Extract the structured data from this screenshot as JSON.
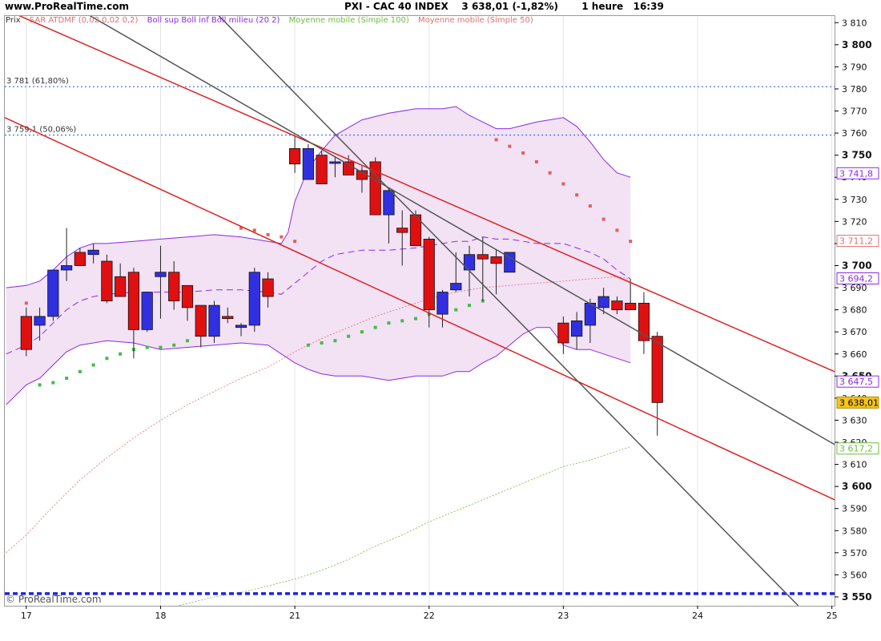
{
  "header": {
    "site": "www.ProRealTime.com",
    "title": "PXI - CAC 40 INDEX    3 638,01 (-1,82%)       1 heure   16:39"
  },
  "watermark": "© ProRealTime.com",
  "legend": [
    {
      "label": "Prix",
      "color": "#333333"
    },
    {
      "label": "SAR ATDMF (0,02 0,02 0,2)",
      "color": "#e07070"
    },
    {
      "label": "Boll sup Boll inf Boll milieu (20 2)",
      "color": "#8a2be2"
    },
    {
      "label": "Moyenne mobile (Simple 100)",
      "color": "#6bbf3a"
    },
    {
      "label": "Moyenne mobile (Simple 50)",
      "color": "#e07070"
    }
  ],
  "colors": {
    "up": "#3030e0",
    "down": "#e01010",
    "band_fill": "#f2e2f4",
    "band_line": "#8a2be2",
    "sar_up": "#44bb44",
    "sar_down": "#e06060",
    "trend_red": "#dd2222",
    "trend_gray": "#555555",
    "fib": "#3366ff",
    "support": "#2222dd",
    "ma50": "#e07070",
    "ma100": "#6bbf3a"
  },
  "chart_data": {
    "type": "candlestick",
    "y_ticks": [
      "3 550",
      "3 560",
      "3 570",
      "3 580",
      "3 590",
      "3 600",
      "3 610",
      "3 620",
      "3 630",
      "3 640",
      "3 650",
      "3 660",
      "3 670",
      "3 680",
      "3 690",
      "3 700",
      "3 710",
      "3 720",
      "3 730",
      "3 740",
      "3 750",
      "3 760",
      "3 770",
      "3 780",
      "3 790",
      "3 800",
      "3 810"
    ],
    "y_tick_values": [
      3550,
      3560,
      3570,
      3580,
      3590,
      3600,
      3610,
      3620,
      3630,
      3640,
      3650,
      3660,
      3670,
      3680,
      3690,
      3700,
      3710,
      3720,
      3730,
      3740,
      3750,
      3760,
      3770,
      3780,
      3790,
      3800,
      3810
    ],
    "bold_ticks": [
      3550,
      3600,
      3650,
      3700,
      3750,
      3800
    ],
    "ylim": [
      3546,
      3813
    ],
    "x_labels": [
      {
        "label": "17",
        "x": 0
      },
      {
        "label": "18",
        "x": 10
      },
      {
        "label": "21",
        "x": 20
      },
      {
        "label": "22",
        "x": 30
      },
      {
        "label": "23",
        "x": 40
      },
      {
        "label": "24",
        "x": 50
      },
      {
        "label": "25",
        "x": 60
      }
    ],
    "xlim": [
      -1.6,
      60.2
    ],
    "candles": [
      [
        3677,
        3681,
        3659,
        3662
      ],
      [
        3673,
        3681,
        3666,
        3677
      ],
      [
        3677,
        3690,
        3675,
        3698
      ],
      [
        3698,
        3717,
        3693,
        3700
      ],
      [
        3706,
        3708,
        3701,
        3700
      ],
      [
        3705,
        3710,
        3701,
        3707
      ],
      [
        3702,
        3705,
        3683,
        3684
      ],
      [
        3695,
        3701,
        3688,
        3686
      ],
      [
        3697,
        3699,
        3658,
        3671
      ],
      [
        3671,
        3685,
        3670,
        3688
      ],
      [
        3695,
        3709,
        3676,
        3697
      ],
      [
        3697,
        3702,
        3680,
        3684
      ],
      [
        3691,
        3690,
        3675,
        3681
      ],
      [
        3682,
        3680,
        3663,
        3668
      ],
      [
        3668,
        3684,
        3665,
        3682
      ],
      [
        3677,
        3681,
        3674,
        3676
      ],
      [
        3672,
        3674,
        3668,
        3673
      ],
      [
        3673,
        3699,
        3670,
        3697
      ],
      [
        3694,
        3697,
        3681,
        3686
      ],
      [
        3753,
        3759,
        3742,
        3746
      ],
      [
        3739,
        3755,
        3742,
        3753
      ],
      [
        3750,
        3752,
        3740,
        3737
      ],
      [
        3747,
        3749,
        3740,
        3747
      ],
      [
        3747,
        3750,
        3742,
        3741
      ],
      [
        3743,
        3745,
        3733,
        3739
      ],
      [
        3747,
        3749,
        3733,
        3723
      ],
      [
        3723,
        3735,
        3710,
        3734
      ],
      [
        3717,
        3725,
        3700,
        3715
      ],
      [
        3723,
        3725,
        3712,
        3709
      ],
      [
        3712,
        3713,
        3672,
        3680
      ],
      [
        3678,
        3689,
        3672,
        3688
      ],
      [
        3689,
        3706,
        3688,
        3692
      ],
      [
        3698,
        3709,
        3686,
        3705
      ],
      [
        3705,
        3713,
        3684,
        3703
      ],
      [
        3704,
        3707,
        3687,
        3701
      ],
      [
        3697,
        3706,
        3698,
        3706
      ],
      [
        3674,
        3677,
        3660,
        3665
      ],
      [
        3668,
        3679,
        3662,
        3675
      ],
      [
        3673,
        3685,
        3665,
        3683
      ],
      [
        3681,
        3690,
        3678,
        3686
      ],
      [
        3684,
        3686,
        3678,
        3680
      ],
      [
        3683,
        3694,
        3680,
        3680
      ],
      [
        3683,
        3688,
        3660,
        3666
      ],
      [
        3668,
        3670,
        3623,
        3638
      ]
    ],
    "candle_x": [
      0,
      1,
      2,
      3,
      4,
      5,
      6,
      7,
      8,
      9,
      10,
      11,
      12,
      13,
      14,
      15,
      16,
      17,
      18,
      20,
      21,
      22,
      23,
      24,
      25,
      26,
      27,
      28,
      29,
      30,
      31,
      32,
      33,
      34,
      35,
      36,
      40,
      41,
      42,
      43,
      44,
      45,
      46,
      47
    ],
    "bollinger_upper": [
      [
        -1.5,
        3690
      ],
      [
        0,
        3691
      ],
      [
        1,
        3693
      ],
      [
        2,
        3698
      ],
      [
        3,
        3704
      ],
      [
        4,
        3708
      ],
      [
        5,
        3710
      ],
      [
        6,
        3710
      ],
      [
        8,
        3711
      ],
      [
        10,
        3712
      ],
      [
        12,
        3713
      ],
      [
        14,
        3714
      ],
      [
        16,
        3713
      ],
      [
        18,
        3711
      ],
      [
        19,
        3710
      ],
      [
        19.5,
        3715
      ],
      [
        20,
        3729
      ],
      [
        21,
        3744
      ],
      [
        22,
        3752
      ],
      [
        23,
        3759
      ],
      [
        25,
        3766
      ],
      [
        27,
        3769
      ],
      [
        29,
        3771
      ],
      [
        31,
        3771
      ],
      [
        32,
        3772
      ],
      [
        33,
        3768
      ],
      [
        34,
        3765
      ],
      [
        35,
        3762
      ],
      [
        36,
        3762
      ],
      [
        38,
        3765
      ],
      [
        40,
        3767
      ],
      [
        41,
        3763
      ],
      [
        42,
        3756
      ],
      [
        43,
        3748
      ],
      [
        44,
        3742
      ],
      [
        45,
        3740
      ]
    ],
    "bollinger_lower": [
      [
        -1.5,
        3637
      ],
      [
        0,
        3646
      ],
      [
        1,
        3649
      ],
      [
        2,
        3655
      ],
      [
        3,
        3661
      ],
      [
        4,
        3664
      ],
      [
        5,
        3665
      ],
      [
        6,
        3666
      ],
      [
        8,
        3665
      ],
      [
        10,
        3662
      ],
      [
        12,
        3663
      ],
      [
        14,
        3664
      ],
      [
        16,
        3665
      ],
      [
        18,
        3664
      ],
      [
        19,
        3660
      ],
      [
        20,
        3656
      ],
      [
        21,
        3653
      ],
      [
        22,
        3651
      ],
      [
        23,
        3650
      ],
      [
        25,
        3650
      ],
      [
        27,
        3648
      ],
      [
        29,
        3650
      ],
      [
        31,
        3650
      ],
      [
        32,
        3652
      ],
      [
        33,
        3652
      ],
      [
        34,
        3656
      ],
      [
        35,
        3659
      ],
      [
        36,
        3664
      ],
      [
        37,
        3669
      ],
      [
        38,
        3672
      ],
      [
        39,
        3672
      ],
      [
        40,
        3664
      ],
      [
        41,
        3662
      ],
      [
        42,
        3662
      ],
      [
        43,
        3660
      ],
      [
        44,
        3658
      ],
      [
        45,
        3656
      ]
    ],
    "bollinger_mid": [
      [
        -1.5,
        3660
      ],
      [
        0,
        3664
      ],
      [
        1,
        3668
      ],
      [
        2,
        3674
      ],
      [
        3,
        3680
      ],
      [
        4,
        3684
      ],
      [
        5,
        3686
      ],
      [
        6,
        3687
      ],
      [
        8,
        3688
      ],
      [
        10,
        3688
      ],
      [
        12,
        3688
      ],
      [
        14,
        3689
      ],
      [
        16,
        3689
      ],
      [
        18,
        3688
      ],
      [
        19,
        3687
      ],
      [
        20,
        3692
      ],
      [
        21,
        3697
      ],
      [
        22,
        3702
      ],
      [
        23,
        3705
      ],
      [
        25,
        3707
      ],
      [
        27,
        3707
      ],
      [
        29,
        3708
      ],
      [
        31,
        3710
      ],
      [
        32,
        3711
      ],
      [
        33,
        3711
      ],
      [
        34,
        3713
      ],
      [
        35,
        3712
      ],
      [
        36,
        3712
      ],
      [
        38,
        3710
      ],
      [
        40,
        3710
      ],
      [
        41,
        3708
      ],
      [
        42,
        3706
      ],
      [
        43,
        3703
      ],
      [
        44,
        3698
      ],
      [
        45,
        3694
      ]
    ],
    "ma50": [
      [
        -1.5,
        3570
      ],
      [
        0,
        3578
      ],
      [
        2,
        3591
      ],
      [
        4,
        3603
      ],
      [
        6,
        3613
      ],
      [
        8,
        3622
      ],
      [
        10,
        3630
      ],
      [
        12,
        3637
      ],
      [
        14,
        3643
      ],
      [
        16,
        3649
      ],
      [
        18,
        3654
      ],
      [
        20,
        3661
      ],
      [
        22,
        3667
      ],
      [
        24,
        3672
      ],
      [
        26,
        3677
      ],
      [
        28,
        3681
      ],
      [
        30,
        3685
      ],
      [
        32,
        3688
      ],
      [
        34,
        3690
      ],
      [
        36,
        3691
      ],
      [
        38,
        3692
      ],
      [
        40,
        3693
      ],
      [
        42,
        3694
      ],
      [
        44,
        3695
      ],
      [
        45,
        3694
      ]
    ],
    "ma100": [
      [
        10,
        3544
      ],
      [
        12,
        3547
      ],
      [
        14,
        3550
      ],
      [
        16,
        3552
      ],
      [
        18,
        3555
      ],
      [
        20,
        3558
      ],
      [
        22,
        3562
      ],
      [
        24,
        3567
      ],
      [
        26,
        3573
      ],
      [
        28,
        3578
      ],
      [
        30,
        3584
      ],
      [
        32,
        3589
      ],
      [
        34,
        3594
      ],
      [
        36,
        3599
      ],
      [
        38,
        3604
      ],
      [
        40,
        3609
      ],
      [
        42,
        3612
      ],
      [
        44,
        3616
      ],
      [
        45,
        3618
      ]
    ],
    "sar": [
      {
        "x": 0,
        "y": 3683,
        "c": "down"
      },
      {
        "x": 1,
        "y": 3646,
        "c": "up"
      },
      {
        "x": 2,
        "y": 3647,
        "c": "up"
      },
      {
        "x": 3,
        "y": 3649,
        "c": "up"
      },
      {
        "x": 4,
        "y": 3652,
        "c": "up"
      },
      {
        "x": 5,
        "y": 3655,
        "c": "up"
      },
      {
        "x": 6,
        "y": 3658,
        "c": "up"
      },
      {
        "x": 7,
        "y": 3660,
        "c": "up"
      },
      {
        "x": 8,
        "y": 3662,
        "c": "up"
      },
      {
        "x": 9,
        "y": 3663,
        "c": "up"
      },
      {
        "x": 10,
        "y": 3663,
        "c": "up"
      },
      {
        "x": 11,
        "y": 3664,
        "c": "up"
      },
      {
        "x": 12,
        "y": 3666,
        "c": "up"
      },
      {
        "x": 13,
        "y": 3671,
        "c": "up"
      },
      {
        "x": 14,
        "y": 3672,
        "c": "up"
      },
      {
        "x": 16,
        "y": 3717,
        "c": "down"
      },
      {
        "x": 17,
        "y": 3716,
        "c": "down"
      },
      {
        "x": 18,
        "y": 3714,
        "c": "down"
      },
      {
        "x": 19,
        "y": 3713,
        "c": "down"
      },
      {
        "x": 20,
        "y": 3711,
        "c": "down"
      },
      {
        "x": 21,
        "y": 3664,
        "c": "up"
      },
      {
        "x": 22,
        "y": 3665,
        "c": "up"
      },
      {
        "x": 23,
        "y": 3666,
        "c": "up"
      },
      {
        "x": 24,
        "y": 3668,
        "c": "up"
      },
      {
        "x": 25,
        "y": 3670,
        "c": "up"
      },
      {
        "x": 26,
        "y": 3672,
        "c": "up"
      },
      {
        "x": 27,
        "y": 3674,
        "c": "up"
      },
      {
        "x": 28,
        "y": 3675,
        "c": "up"
      },
      {
        "x": 29,
        "y": 3676,
        "c": "up"
      },
      {
        "x": 30,
        "y": 3678,
        "c": "up"
      },
      {
        "x": 31,
        "y": 3679,
        "c": "up"
      },
      {
        "x": 32,
        "y": 3680,
        "c": "up"
      },
      {
        "x": 33,
        "y": 3682,
        "c": "up"
      },
      {
        "x": 34,
        "y": 3684,
        "c": "up"
      },
      {
        "x": 35,
        "y": 3757,
        "c": "down"
      },
      {
        "x": 36,
        "y": 3754,
        "c": "down"
      },
      {
        "x": 37,
        "y": 3751,
        "c": "down"
      },
      {
        "x": 38,
        "y": 3747,
        "c": "down"
      },
      {
        "x": 39,
        "y": 3742,
        "c": "down"
      },
      {
        "x": 40,
        "y": 3737,
        "c": "down"
      },
      {
        "x": 41,
        "y": 3732,
        "c": "down"
      },
      {
        "x": 42,
        "y": 3727,
        "c": "down"
      },
      {
        "x": 43,
        "y": 3721,
        "c": "down"
      },
      {
        "x": 44,
        "y": 3716,
        "c": "down"
      },
      {
        "x": 45,
        "y": 3711,
        "c": "down"
      }
    ],
    "trend_lines": [
      {
        "color": "red",
        "p1": [
          -1.6,
          3816
        ],
        "p2": [
          60.2,
          3652
        ]
      },
      {
        "color": "red",
        "p1": [
          -1.6,
          3767
        ],
        "p2": [
          60.2,
          3594
        ]
      },
      {
        "color": "gray",
        "p1": [
          4.5,
          3814
        ],
        "p2": [
          60.2,
          3619
        ]
      },
      {
        "color": "gray",
        "p1": [
          14.2,
          3814
        ],
        "p2": [
          57.5,
          3546
        ]
      }
    ],
    "fib_levels": [
      {
        "label": "3 781 (61,80%)",
        "value": 3781
      },
      {
        "label": "3 759,1 (50,06%)",
        "value": 3759.1
      }
    ],
    "support_level": 3551.5,
    "value_tags": [
      {
        "label": "3 741,8",
        "value": 3741.8,
        "bg": "#ffffff",
        "fg": "#8a2be2",
        "border": "#8a2be2"
      },
      {
        "label": "3 711,2",
        "value": 3711.2,
        "bg": "#ffffff",
        "fg": "#e07070",
        "border": "#e07070"
      },
      {
        "label": "3 694,2",
        "value": 3694.2,
        "bg": "#ffffff",
        "fg": "#8a2be2",
        "border": "#8a2be2"
      },
      {
        "label": "3 647,5",
        "value": 3647.5,
        "bg": "#ffffff",
        "fg": "#8a2be2",
        "border": "#8a2be2"
      },
      {
        "label": "3 638,01",
        "value": 3638.01,
        "bg": "#f5c518",
        "fg": "#000000",
        "border": "#b08a00"
      },
      {
        "label": "3 617,2",
        "value": 3617.2,
        "bg": "#ffffff",
        "fg": "#6bbf3a",
        "border": "#6bbf3a"
      }
    ]
  }
}
